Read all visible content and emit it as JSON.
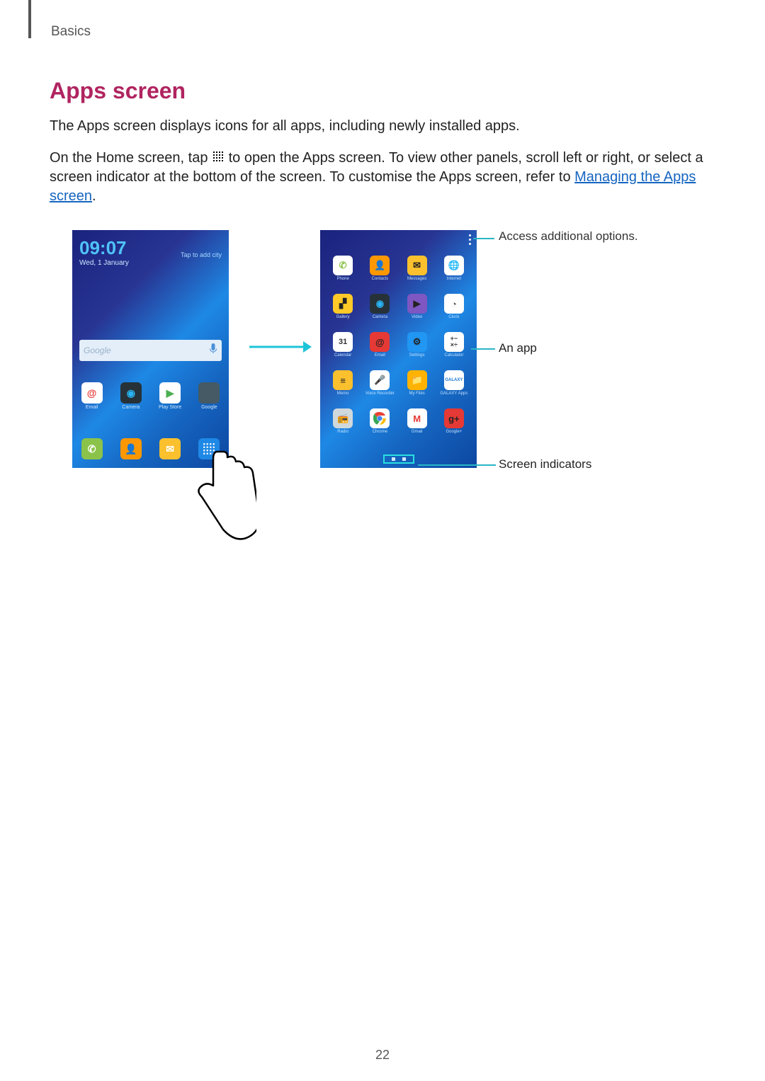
{
  "header": {
    "section": "Basics"
  },
  "title": "Apps screen",
  "para1": "The Apps screen displays icons for all apps, including newly installed apps.",
  "para2_a": "On the Home screen, tap ",
  "para2_b": " to open the Apps screen. To view other panels, scroll left or right, or select a screen indicator at the bottom of the screen. To customise the Apps screen, refer to ",
  "link": "Managing the Apps screen",
  "para2_c": ".",
  "home": {
    "time": "09:07",
    "date": "Wed, 1 January",
    "tap_city": "Tap to add city",
    "search_placeholder": "Google",
    "row1": [
      {
        "label": "Email"
      },
      {
        "label": "Camera"
      },
      {
        "label": "Play Store"
      },
      {
        "label": "Google"
      }
    ],
    "dock": [
      {
        "label": ""
      },
      {
        "label": ""
      },
      {
        "label": ""
      },
      {
        "label": ""
      }
    ]
  },
  "apps": {
    "grid": [
      {
        "label": "Phone"
      },
      {
        "label": "Contacts"
      },
      {
        "label": "Messages"
      },
      {
        "label": "Internet"
      },
      {
        "label": "Gallery"
      },
      {
        "label": "Camera"
      },
      {
        "label": "Video"
      },
      {
        "label": "Clock"
      },
      {
        "label": "Calendar",
        "badge": "31"
      },
      {
        "label": "Email"
      },
      {
        "label": "Settings"
      },
      {
        "label": "Calculator"
      },
      {
        "label": "Memo"
      },
      {
        "label": "Voice Recorder"
      },
      {
        "label": "My Files"
      },
      {
        "label": "GALAXY Apps"
      },
      {
        "label": "Radio"
      },
      {
        "label": "Chrome"
      },
      {
        "label": "Gmail"
      },
      {
        "label": "Google+"
      }
    ]
  },
  "callouts": {
    "options": "Access additional options.",
    "an_app": "An app",
    "indicators": "Screen indicators"
  },
  "page_number": "22"
}
